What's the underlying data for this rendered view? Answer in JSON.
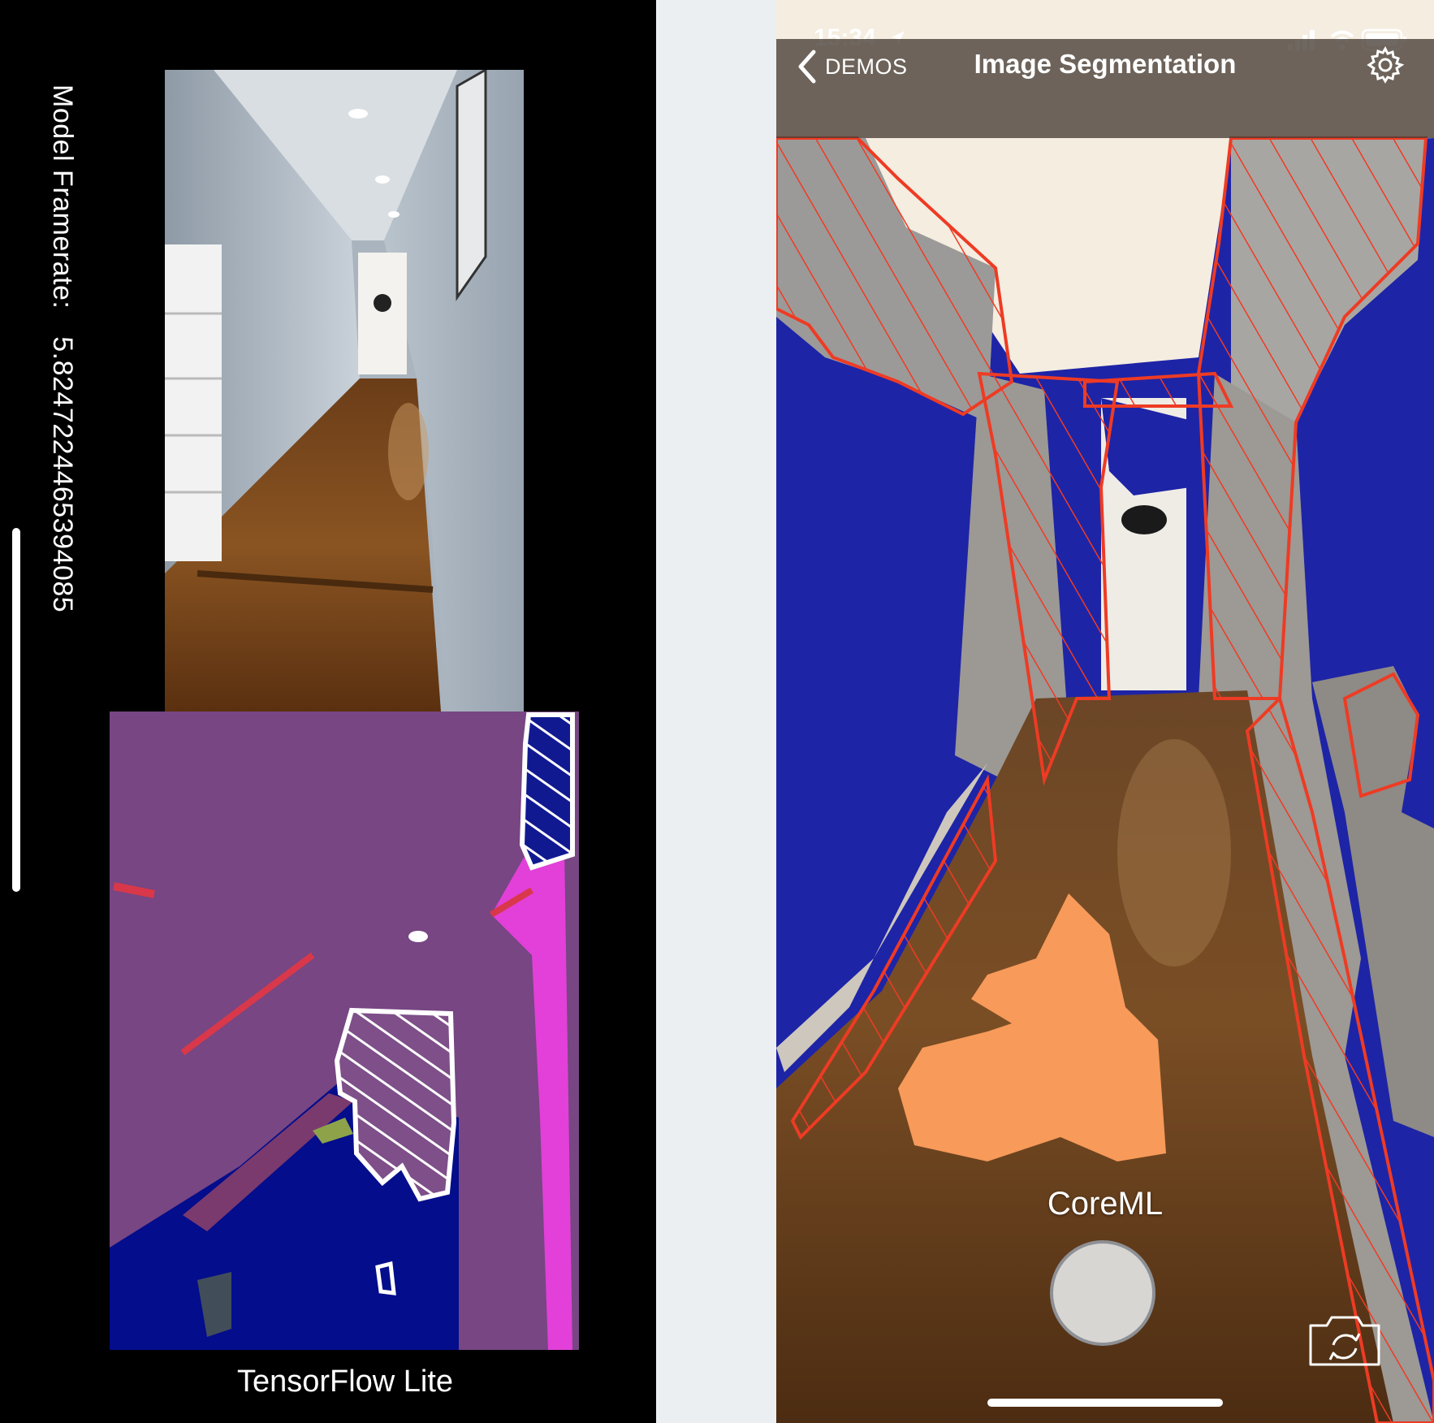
{
  "left_panel": {
    "framerate_label": "Model Framerate:",
    "framerate_value": "5.82472244653940​85",
    "footer_label": "TensorFlow Lite"
  },
  "right_panel": {
    "status_time": "15:34",
    "back_label": "DEMOS",
    "title": "Image Segmentation",
    "model_label": "CoreML"
  },
  "colors": {
    "seg_background_purple": "#774683",
    "seg_floor_navy": "#040d8b",
    "seg_wall_magenta": "#e240d8",
    "seg_wall_blue_coreml": "#1e24a6",
    "seg_person_orange": "#f79a5a",
    "annotation_red": "#ee3b24",
    "annotation_white": "#ffffff"
  },
  "icons": {
    "back": "chevron-left-icon",
    "settings": "gear-icon",
    "switch_camera": "camera-switch-icon",
    "location": "location-arrow-icon",
    "signal": "cellular-signal-icon",
    "wifi": "wifi-icon",
    "battery": "battery-icon"
  }
}
